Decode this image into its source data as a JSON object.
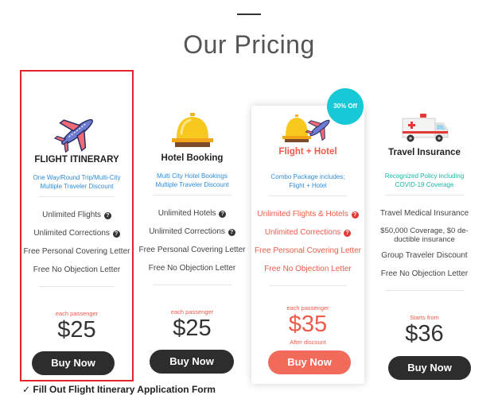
{
  "header": {
    "title": "Our Pricing"
  },
  "colors": {
    "accent_red": "#f05a4a",
    "cyan": "#17c9d6",
    "button_dark": "#2d2d2d",
    "highlight_border": "#e3262b"
  },
  "cards": [
    {
      "name": "FLIGHT ITINERARY",
      "icon": "airplane-icon",
      "subtitle": [
        "One Way/Round Trip/Multi-City",
        "Multiple Traveler Discount"
      ],
      "features": [
        "Unlimited Flights",
        "Unlimited Corrections",
        "Free Personal Covering Letter",
        "Free No Objection Letter"
      ],
      "price_label": "each passenger",
      "price": "$25",
      "button": "Buy Now"
    },
    {
      "name": "Hotel Booking",
      "icon": "service-bell-icon",
      "subtitle": [
        "Multi City Hotel Bookings",
        "Multiple Traveler Discount"
      ],
      "features": [
        "Unlimited Hotels",
        "Unlimited Corrections",
        "Free Personal Covering Letter",
        "Free No Objection Letter"
      ],
      "price_label": "each passenger",
      "price": "$25",
      "button": "Buy Now"
    },
    {
      "name": "Flight + Hotel",
      "icon": "bell-and-airplane-icon",
      "badge": "30% Off",
      "subtitle": [
        "Combo Package includes;",
        "Flight + Hotel"
      ],
      "features": [
        "Unlimited Flights & Hotels",
        "Unlimited Corrections",
        "Free Personal Covering Letter",
        "Free No Objection Letter"
      ],
      "price_label": "each passenger",
      "price": "$35",
      "after_discount": "After discount",
      "button": "Buy Now"
    },
    {
      "name": "Travel Insurance",
      "icon": "ambulance-icon",
      "subtitle": [
        "Recognized Policy including",
        "COVID-19 Coverage"
      ],
      "features": [
        "Travel Medical Insurance",
        "$50,000 Coverage, $0 de-ductible insurance",
        "Group Traveler Discount",
        "Free No Objection Letter"
      ],
      "price_label": "Starts from",
      "price": "$36",
      "button": "Buy Now"
    }
  ],
  "footer_partial": "✓ Fill Out Flight Itinerary Application Form"
}
